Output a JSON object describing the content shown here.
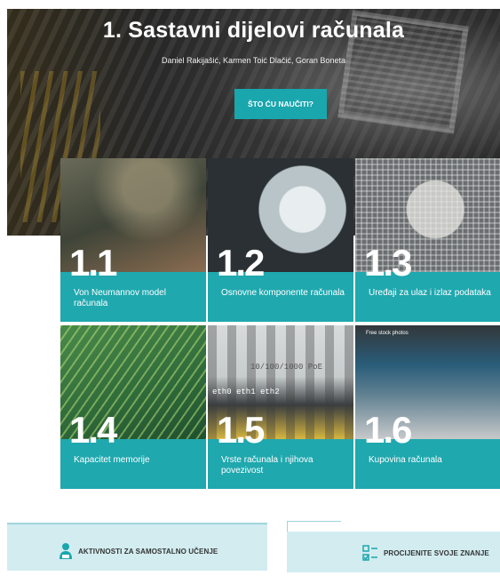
{
  "hero": {
    "title": "1. Sastavni dijelovi računala",
    "authors": "Daniel Rakijašić, Karmen Toić Dlačić, Goran Boneta",
    "button_label": "ŠTO ĆU NAUČITI?"
  },
  "cards": [
    {
      "number": "1.1",
      "label": "Von Neumannov model računala"
    },
    {
      "number": "1.2",
      "label": "Osnovne komponente računala"
    },
    {
      "number": "1.3",
      "label": "Uređaji za ulaz i izlaz podataka"
    },
    {
      "number": "1.4",
      "label": "Kapacitet memorije"
    },
    {
      "number": "1.5",
      "label": "Vrste računala i njihova povezivost"
    },
    {
      "number": "1.6",
      "label": "Kupovina računala"
    }
  ],
  "card_image_text": {
    "switch_speed": "10/100/1000 PoE",
    "switch_ports": "eth0   eth1   eth2",
    "laptop_screen": "Free stock photos"
  },
  "bottom": {
    "self_study_label": "AKTIVNOSTI ZA SAMOSTALNO UČENJE",
    "assess_label": "PROCIJENITE SVOJE ZNANJE"
  },
  "colors": {
    "accent": "#1aa6ad",
    "card_overlay": "#1fa8ae",
    "bottom_panel": "#d2ecf0"
  }
}
